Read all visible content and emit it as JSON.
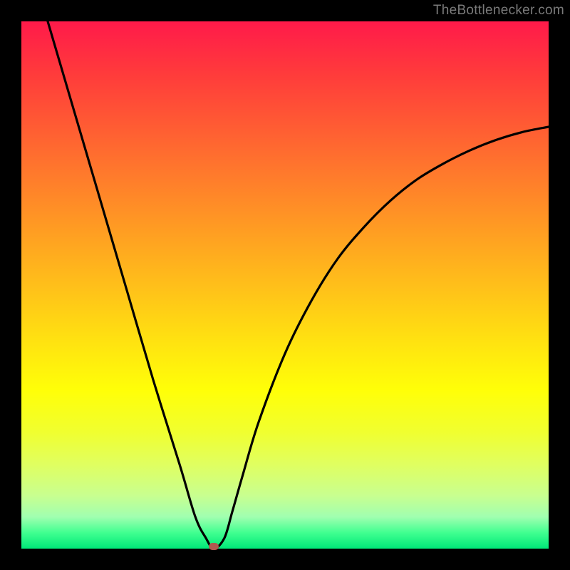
{
  "attribution": "TheBottlenecker.com",
  "chart_data": {
    "type": "line",
    "title": "",
    "xlabel": "",
    "ylabel": "",
    "xlim": [
      0,
      100
    ],
    "ylim": [
      0,
      100
    ],
    "background_gradient": {
      "top_color": "#ff1a4a",
      "bottom_color": "#00e878"
    },
    "series": [
      {
        "name": "bottleneck-curve",
        "x": [
          5,
          10,
          15,
          20,
          25,
          30,
          33,
          35,
          36.5,
          38.5,
          40,
          42,
          45,
          50,
          55,
          60,
          65,
          70,
          75,
          80,
          85,
          90,
          95,
          100
        ],
        "y": [
          100,
          83,
          66,
          49,
          32,
          16,
          6,
          2,
          0,
          2,
          7,
          14,
          24,
          37,
          47,
          55,
          61,
          66,
          70,
          73,
          75.5,
          77.5,
          79,
          80
        ]
      }
    ],
    "marker": {
      "name": "minimum-point",
      "x": 36.5,
      "y": 0,
      "color": "#b05850"
    }
  }
}
